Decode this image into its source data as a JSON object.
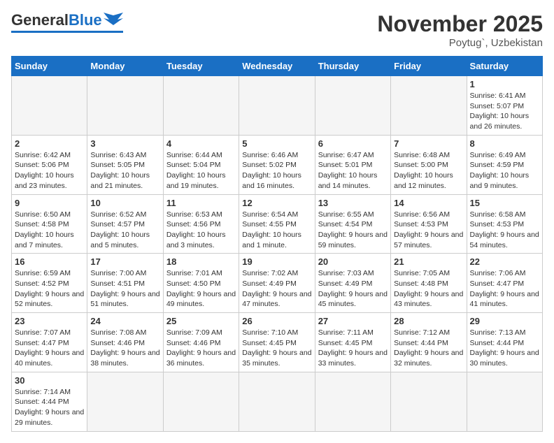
{
  "header": {
    "logo_general": "General",
    "logo_blue": "Blue",
    "month_title": "November 2025",
    "location": "Poytug`, Uzbekistan"
  },
  "weekdays": [
    "Sunday",
    "Monday",
    "Tuesday",
    "Wednesday",
    "Thursday",
    "Friday",
    "Saturday"
  ],
  "weeks": [
    [
      {
        "day": "",
        "info": ""
      },
      {
        "day": "",
        "info": ""
      },
      {
        "day": "",
        "info": ""
      },
      {
        "day": "",
        "info": ""
      },
      {
        "day": "",
        "info": ""
      },
      {
        "day": "",
        "info": ""
      },
      {
        "day": "1",
        "info": "Sunrise: 6:41 AM\nSunset: 5:07 PM\nDaylight: 10 hours\nand 26 minutes."
      }
    ],
    [
      {
        "day": "2",
        "info": "Sunrise: 6:42 AM\nSunset: 5:06 PM\nDaylight: 10 hours\nand 23 minutes."
      },
      {
        "day": "3",
        "info": "Sunrise: 6:43 AM\nSunset: 5:05 PM\nDaylight: 10 hours\nand 21 minutes."
      },
      {
        "day": "4",
        "info": "Sunrise: 6:44 AM\nSunset: 5:04 PM\nDaylight: 10 hours\nand 19 minutes."
      },
      {
        "day": "5",
        "info": "Sunrise: 6:46 AM\nSunset: 5:02 PM\nDaylight: 10 hours\nand 16 minutes."
      },
      {
        "day": "6",
        "info": "Sunrise: 6:47 AM\nSunset: 5:01 PM\nDaylight: 10 hours\nand 14 minutes."
      },
      {
        "day": "7",
        "info": "Sunrise: 6:48 AM\nSunset: 5:00 PM\nDaylight: 10 hours\nand 12 minutes."
      },
      {
        "day": "8",
        "info": "Sunrise: 6:49 AM\nSunset: 4:59 PM\nDaylight: 10 hours\nand 9 minutes."
      }
    ],
    [
      {
        "day": "9",
        "info": "Sunrise: 6:50 AM\nSunset: 4:58 PM\nDaylight: 10 hours\nand 7 minutes."
      },
      {
        "day": "10",
        "info": "Sunrise: 6:52 AM\nSunset: 4:57 PM\nDaylight: 10 hours\nand 5 minutes."
      },
      {
        "day": "11",
        "info": "Sunrise: 6:53 AM\nSunset: 4:56 PM\nDaylight: 10 hours\nand 3 minutes."
      },
      {
        "day": "12",
        "info": "Sunrise: 6:54 AM\nSunset: 4:55 PM\nDaylight: 10 hours\nand 1 minute."
      },
      {
        "day": "13",
        "info": "Sunrise: 6:55 AM\nSunset: 4:54 PM\nDaylight: 9 hours\nand 59 minutes."
      },
      {
        "day": "14",
        "info": "Sunrise: 6:56 AM\nSunset: 4:53 PM\nDaylight: 9 hours\nand 57 minutes."
      },
      {
        "day": "15",
        "info": "Sunrise: 6:58 AM\nSunset: 4:53 PM\nDaylight: 9 hours\nand 54 minutes."
      }
    ],
    [
      {
        "day": "16",
        "info": "Sunrise: 6:59 AM\nSunset: 4:52 PM\nDaylight: 9 hours\nand 52 minutes."
      },
      {
        "day": "17",
        "info": "Sunrise: 7:00 AM\nSunset: 4:51 PM\nDaylight: 9 hours\nand 51 minutes."
      },
      {
        "day": "18",
        "info": "Sunrise: 7:01 AM\nSunset: 4:50 PM\nDaylight: 9 hours\nand 49 minutes."
      },
      {
        "day": "19",
        "info": "Sunrise: 7:02 AM\nSunset: 4:49 PM\nDaylight: 9 hours\nand 47 minutes."
      },
      {
        "day": "20",
        "info": "Sunrise: 7:03 AM\nSunset: 4:49 PM\nDaylight: 9 hours\nand 45 minutes."
      },
      {
        "day": "21",
        "info": "Sunrise: 7:05 AM\nSunset: 4:48 PM\nDaylight: 9 hours\nand 43 minutes."
      },
      {
        "day": "22",
        "info": "Sunrise: 7:06 AM\nSunset: 4:47 PM\nDaylight: 9 hours\nand 41 minutes."
      }
    ],
    [
      {
        "day": "23",
        "info": "Sunrise: 7:07 AM\nSunset: 4:47 PM\nDaylight: 9 hours\nand 40 minutes."
      },
      {
        "day": "24",
        "info": "Sunrise: 7:08 AM\nSunset: 4:46 PM\nDaylight: 9 hours\nand 38 minutes."
      },
      {
        "day": "25",
        "info": "Sunrise: 7:09 AM\nSunset: 4:46 PM\nDaylight: 9 hours\nand 36 minutes."
      },
      {
        "day": "26",
        "info": "Sunrise: 7:10 AM\nSunset: 4:45 PM\nDaylight: 9 hours\nand 35 minutes."
      },
      {
        "day": "27",
        "info": "Sunrise: 7:11 AM\nSunset: 4:45 PM\nDaylight: 9 hours\nand 33 minutes."
      },
      {
        "day": "28",
        "info": "Sunrise: 7:12 AM\nSunset: 4:44 PM\nDaylight: 9 hours\nand 32 minutes."
      },
      {
        "day": "29",
        "info": "Sunrise: 7:13 AM\nSunset: 4:44 PM\nDaylight: 9 hours\nand 30 minutes."
      }
    ],
    [
      {
        "day": "30",
        "info": "Sunrise: 7:14 AM\nSunset: 4:44 PM\nDaylight: 9 hours\nand 29 minutes."
      },
      {
        "day": "",
        "info": ""
      },
      {
        "day": "",
        "info": ""
      },
      {
        "day": "",
        "info": ""
      },
      {
        "day": "",
        "info": ""
      },
      {
        "day": "",
        "info": ""
      },
      {
        "day": "",
        "info": ""
      }
    ]
  ]
}
